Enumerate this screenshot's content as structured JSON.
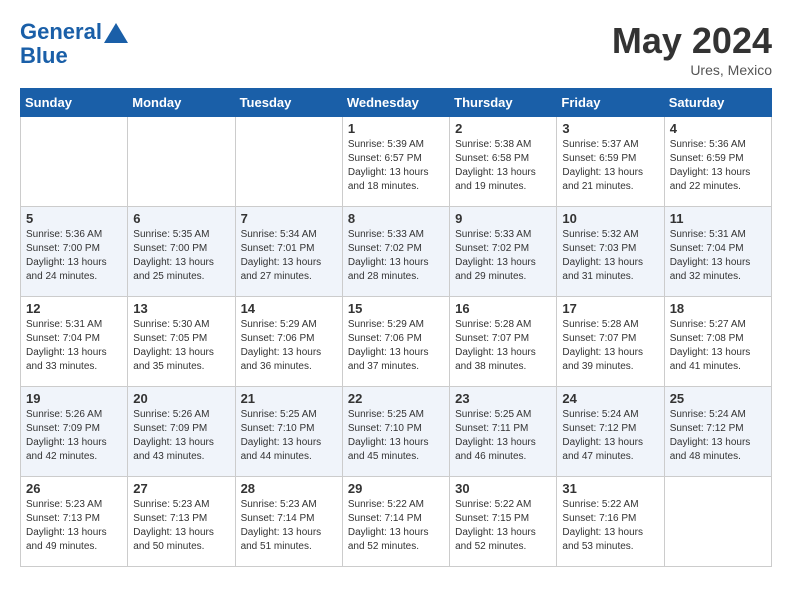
{
  "header": {
    "logo_line1": "General",
    "logo_line2": "Blue",
    "month": "May 2024",
    "location": "Ures, Mexico"
  },
  "days_of_week": [
    "Sunday",
    "Monday",
    "Tuesday",
    "Wednesday",
    "Thursday",
    "Friday",
    "Saturday"
  ],
  "weeks": [
    [
      {
        "day": "",
        "content": ""
      },
      {
        "day": "",
        "content": ""
      },
      {
        "day": "",
        "content": ""
      },
      {
        "day": "1",
        "content": "Sunrise: 5:39 AM\nSunset: 6:57 PM\nDaylight: 13 hours\nand 18 minutes."
      },
      {
        "day": "2",
        "content": "Sunrise: 5:38 AM\nSunset: 6:58 PM\nDaylight: 13 hours\nand 19 minutes."
      },
      {
        "day": "3",
        "content": "Sunrise: 5:37 AM\nSunset: 6:59 PM\nDaylight: 13 hours\nand 21 minutes."
      },
      {
        "day": "4",
        "content": "Sunrise: 5:36 AM\nSunset: 6:59 PM\nDaylight: 13 hours\nand 22 minutes."
      }
    ],
    [
      {
        "day": "5",
        "content": "Sunrise: 5:36 AM\nSunset: 7:00 PM\nDaylight: 13 hours\nand 24 minutes."
      },
      {
        "day": "6",
        "content": "Sunrise: 5:35 AM\nSunset: 7:00 PM\nDaylight: 13 hours\nand 25 minutes."
      },
      {
        "day": "7",
        "content": "Sunrise: 5:34 AM\nSunset: 7:01 PM\nDaylight: 13 hours\nand 27 minutes."
      },
      {
        "day": "8",
        "content": "Sunrise: 5:33 AM\nSunset: 7:02 PM\nDaylight: 13 hours\nand 28 minutes."
      },
      {
        "day": "9",
        "content": "Sunrise: 5:33 AM\nSunset: 7:02 PM\nDaylight: 13 hours\nand 29 minutes."
      },
      {
        "day": "10",
        "content": "Sunrise: 5:32 AM\nSunset: 7:03 PM\nDaylight: 13 hours\nand 31 minutes."
      },
      {
        "day": "11",
        "content": "Sunrise: 5:31 AM\nSunset: 7:04 PM\nDaylight: 13 hours\nand 32 minutes."
      }
    ],
    [
      {
        "day": "12",
        "content": "Sunrise: 5:31 AM\nSunset: 7:04 PM\nDaylight: 13 hours\nand 33 minutes."
      },
      {
        "day": "13",
        "content": "Sunrise: 5:30 AM\nSunset: 7:05 PM\nDaylight: 13 hours\nand 35 minutes."
      },
      {
        "day": "14",
        "content": "Sunrise: 5:29 AM\nSunset: 7:06 PM\nDaylight: 13 hours\nand 36 minutes."
      },
      {
        "day": "15",
        "content": "Sunrise: 5:29 AM\nSunset: 7:06 PM\nDaylight: 13 hours\nand 37 minutes."
      },
      {
        "day": "16",
        "content": "Sunrise: 5:28 AM\nSunset: 7:07 PM\nDaylight: 13 hours\nand 38 minutes."
      },
      {
        "day": "17",
        "content": "Sunrise: 5:28 AM\nSunset: 7:07 PM\nDaylight: 13 hours\nand 39 minutes."
      },
      {
        "day": "18",
        "content": "Sunrise: 5:27 AM\nSunset: 7:08 PM\nDaylight: 13 hours\nand 41 minutes."
      }
    ],
    [
      {
        "day": "19",
        "content": "Sunrise: 5:26 AM\nSunset: 7:09 PM\nDaylight: 13 hours\nand 42 minutes."
      },
      {
        "day": "20",
        "content": "Sunrise: 5:26 AM\nSunset: 7:09 PM\nDaylight: 13 hours\nand 43 minutes."
      },
      {
        "day": "21",
        "content": "Sunrise: 5:25 AM\nSunset: 7:10 PM\nDaylight: 13 hours\nand 44 minutes."
      },
      {
        "day": "22",
        "content": "Sunrise: 5:25 AM\nSunset: 7:10 PM\nDaylight: 13 hours\nand 45 minutes."
      },
      {
        "day": "23",
        "content": "Sunrise: 5:25 AM\nSunset: 7:11 PM\nDaylight: 13 hours\nand 46 minutes."
      },
      {
        "day": "24",
        "content": "Sunrise: 5:24 AM\nSunset: 7:12 PM\nDaylight: 13 hours\nand 47 minutes."
      },
      {
        "day": "25",
        "content": "Sunrise: 5:24 AM\nSunset: 7:12 PM\nDaylight: 13 hours\nand 48 minutes."
      }
    ],
    [
      {
        "day": "26",
        "content": "Sunrise: 5:23 AM\nSunset: 7:13 PM\nDaylight: 13 hours\nand 49 minutes."
      },
      {
        "day": "27",
        "content": "Sunrise: 5:23 AM\nSunset: 7:13 PM\nDaylight: 13 hours\nand 50 minutes."
      },
      {
        "day": "28",
        "content": "Sunrise: 5:23 AM\nSunset: 7:14 PM\nDaylight: 13 hours\nand 51 minutes."
      },
      {
        "day": "29",
        "content": "Sunrise: 5:22 AM\nSunset: 7:14 PM\nDaylight: 13 hours\nand 52 minutes."
      },
      {
        "day": "30",
        "content": "Sunrise: 5:22 AM\nSunset: 7:15 PM\nDaylight: 13 hours\nand 52 minutes."
      },
      {
        "day": "31",
        "content": "Sunrise: 5:22 AM\nSunset: 7:16 PM\nDaylight: 13 hours\nand 53 minutes."
      },
      {
        "day": "",
        "content": ""
      }
    ]
  ]
}
